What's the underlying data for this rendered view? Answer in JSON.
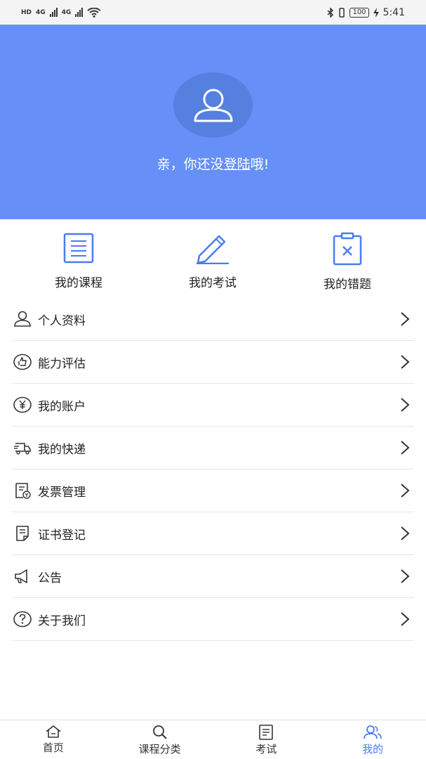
{
  "status_bar": {
    "hd": "HD",
    "sim1": "4G",
    "sim2": "4G",
    "battery": "100",
    "time": "5:41"
  },
  "hero": {
    "prefix": "亲，你还没",
    "login_link": "登陆",
    "suffix": "哦!"
  },
  "quick_actions": [
    {
      "label": "我的课程",
      "icon": "document-icon"
    },
    {
      "label": "我的考试",
      "icon": "pencil-icon"
    },
    {
      "label": "我的错题",
      "icon": "clipboard-x-icon"
    }
  ],
  "menu": [
    {
      "label": "个人资料",
      "icon": "person-icon"
    },
    {
      "label": "能力评估",
      "icon": "thumbs-up-icon"
    },
    {
      "label": "我的账户",
      "icon": "yen-icon"
    },
    {
      "label": "我的快递",
      "icon": "truck-icon"
    },
    {
      "label": "发票管理",
      "icon": "invoice-icon"
    },
    {
      "label": "证书登记",
      "icon": "certificate-icon"
    },
    {
      "label": "公告",
      "icon": "megaphone-icon"
    },
    {
      "label": "关于我们",
      "icon": "question-icon"
    }
  ],
  "tabs": [
    {
      "label": "首页",
      "icon": "home-icon",
      "active": false
    },
    {
      "label": "课程分类",
      "icon": "search-icon",
      "active": false
    },
    {
      "label": "考试",
      "icon": "exam-icon",
      "active": false
    },
    {
      "label": "我的",
      "icon": "users-icon",
      "active": true
    }
  ],
  "colors": {
    "accent": "#6690f8",
    "avatar_bg": "#5580e0",
    "active_tab": "#4a7cf0",
    "icon_blue": "#4a7cf0"
  }
}
